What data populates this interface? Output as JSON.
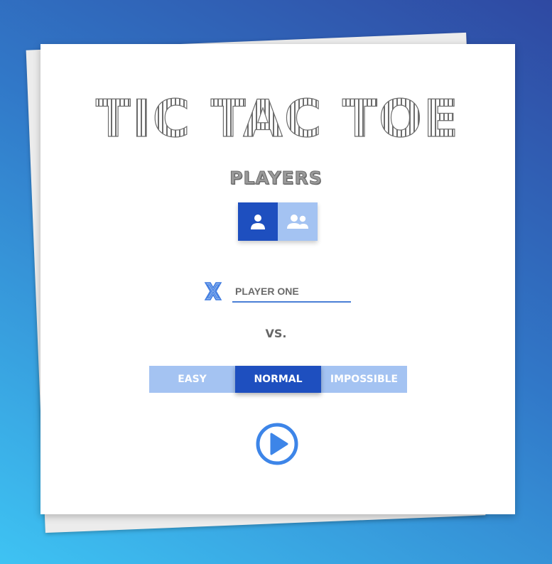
{
  "app": {
    "title": "TIC TAC TOE"
  },
  "players": {
    "label": "PLAYERS",
    "modes": [
      {
        "icon": "single-user-icon",
        "selected": true
      },
      {
        "icon": "two-users-icon",
        "selected": false
      }
    ]
  },
  "player_one": {
    "mark_icon": "x-mark-icon",
    "name_value": "PLAYER ONE"
  },
  "versus": {
    "label": "VS."
  },
  "difficulty": {
    "options": [
      {
        "label": "EASY",
        "selected": false
      },
      {
        "label": "NORMAL",
        "selected": true
      },
      {
        "label": "IMPOSSIBLE",
        "selected": false
      }
    ]
  },
  "play": {
    "icon": "play-circle-icon"
  },
  "colors": {
    "accent": "#1e4fbf",
    "accent_light": "#a4c3f2",
    "x_mark": "#4a86e0",
    "play": "#3d85e8"
  }
}
